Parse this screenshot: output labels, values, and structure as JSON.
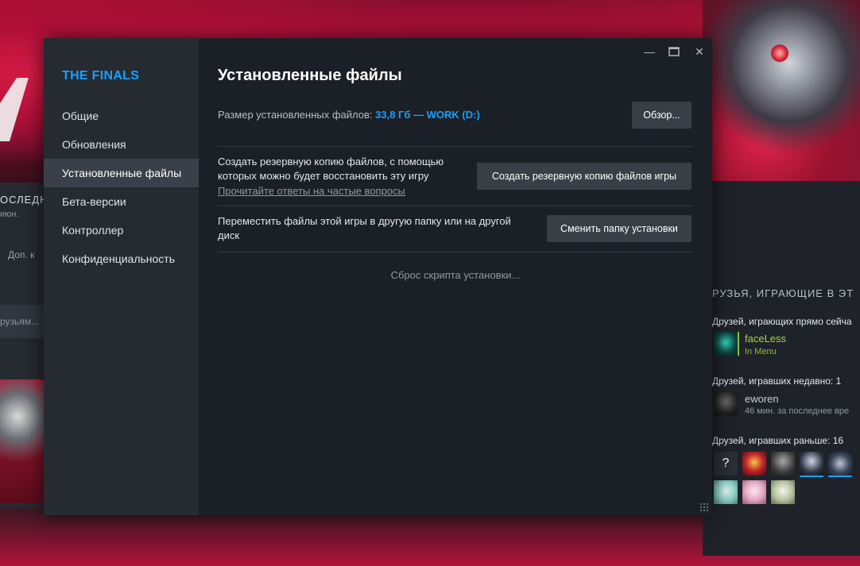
{
  "background": {
    "left_lastplayed": "ОСЛЕДН",
    "left_date": "июн.",
    "left_dop": "Доп. к",
    "left_friends_input": "рузьям...",
    "right_heading": "РУЗЬЯ, ИГРАЮЩИЕ В ЭТ",
    "friends_now_label": "Друзей, играющих прямо сейча",
    "friend_now": {
      "name": "faceLess",
      "status": "In Menu"
    },
    "friends_recent_label": "Друзей, игравших недавно: 1",
    "friend_recent": {
      "name": "eworen",
      "status": "46 мин. за последнее вре"
    },
    "friends_before_label": "Друзей, игравших раньше: 16",
    "unknown_avatar": "?"
  },
  "dialog": {
    "game_title": "THE FINALS",
    "nav": [
      {
        "label": "Общие"
      },
      {
        "label": "Обновления"
      },
      {
        "label": "Установленные файлы"
      },
      {
        "label": "Бета-версии"
      },
      {
        "label": "Контроллер"
      },
      {
        "label": "Конфиденциальность"
      }
    ],
    "active_nav": "Установленные файлы",
    "window_controls": {
      "minimize": "—",
      "maximize": "□",
      "close": "✕"
    },
    "page_title": "Установленные файлы",
    "size_label": "Размер установленных файлов:",
    "size_value": "33,8 Гб — WORK (D:)",
    "browse_button": "Обзор...",
    "backup_desc_1": "Создать резервную копию файлов, с помощью",
    "backup_desc_2": "которых можно будет восстановить эту игру",
    "faq_link": "Прочитайте ответы на частые вопросы",
    "backup_button": "Создать резервную копию файлов игры",
    "move_desc_1": "Переместить файлы этой игры в другую папку или на другой",
    "move_desc_2": "диск",
    "move_button": "Сменить папку установки",
    "reset_script": "Сброс скрипта установки..."
  },
  "colors": {
    "accent": "#1a9fff",
    "in_game": "#90ba3c",
    "sidebar": "#262b32",
    "content": "#1b2027"
  }
}
